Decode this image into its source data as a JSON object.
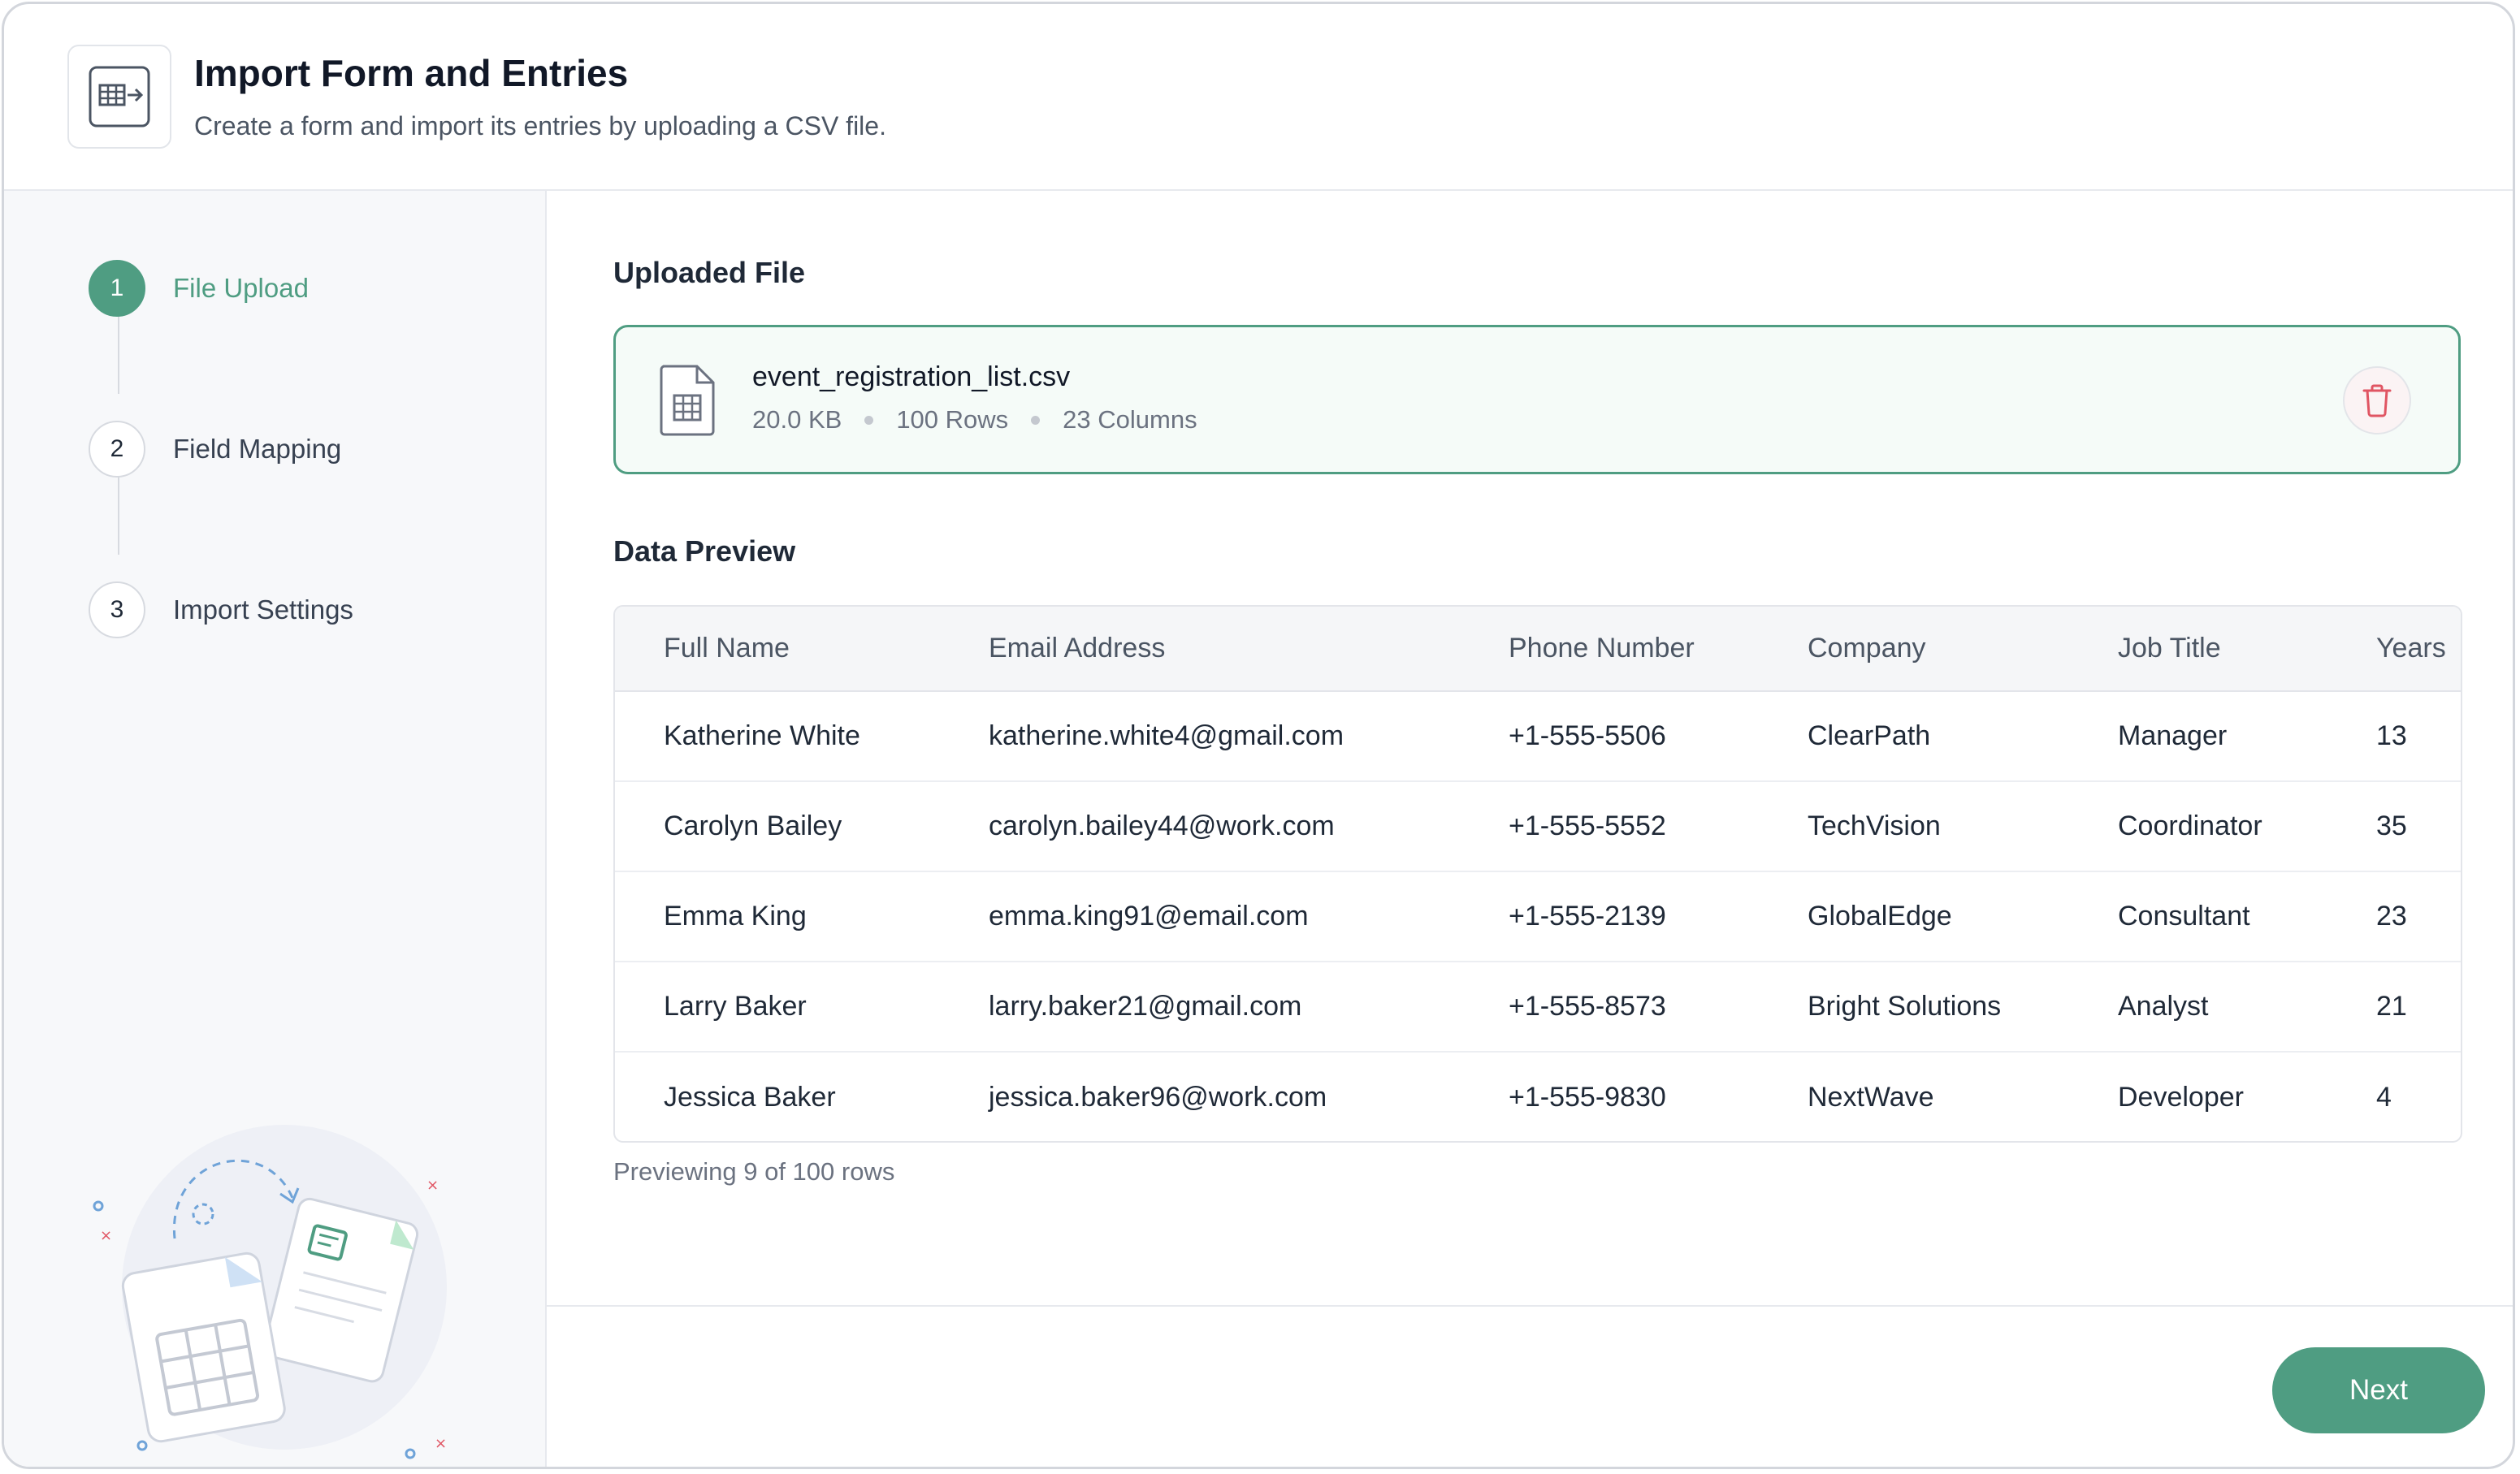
{
  "header": {
    "title": "Import Form and Entries",
    "subtitle": "Create a form and import its entries by uploading a CSV file.",
    "icon": "table-import-icon"
  },
  "steps": [
    {
      "number": "1",
      "label": "File Upload",
      "active": true
    },
    {
      "number": "2",
      "label": "Field Mapping",
      "active": false
    },
    {
      "number": "3",
      "label": "Import Settings",
      "active": false
    }
  ],
  "uploaded_file": {
    "section_title": "Uploaded File",
    "name": "event_registration_list.csv",
    "size": "20.0 KB",
    "rows": "100 Rows",
    "columns": "23 Columns",
    "delete_icon": "trash-icon"
  },
  "preview": {
    "section_title": "Data Preview",
    "columns": [
      "Full Name",
      "Email Address",
      "Phone Number",
      "Company",
      "Job Title",
      "Years"
    ],
    "rows": [
      [
        "Katherine White",
        "katherine.white4@gmail.com",
        "+1-555-5506",
        "ClearPath",
        "Manager",
        "13"
      ],
      [
        "Carolyn Bailey",
        "carolyn.bailey44@work.com",
        "+1-555-5552",
        "TechVision",
        "Coordinator",
        "35"
      ],
      [
        "Emma King",
        "emma.king91@email.com",
        "+1-555-2139",
        "GlobalEdge",
        "Consultant",
        "23"
      ],
      [
        "Larry Baker",
        "larry.baker21@gmail.com",
        "+1-555-8573",
        "Bright Solutions",
        "Analyst",
        "21"
      ],
      [
        "Jessica Baker",
        "jessica.baker96@work.com",
        "+1-555-9830",
        "NextWave",
        "Developer",
        "4"
      ]
    ],
    "note": "Previewing 9 of 100 rows"
  },
  "footer": {
    "next_label": "Next"
  },
  "colors": {
    "accent": "#4f9d82",
    "danger": "#e05563"
  }
}
